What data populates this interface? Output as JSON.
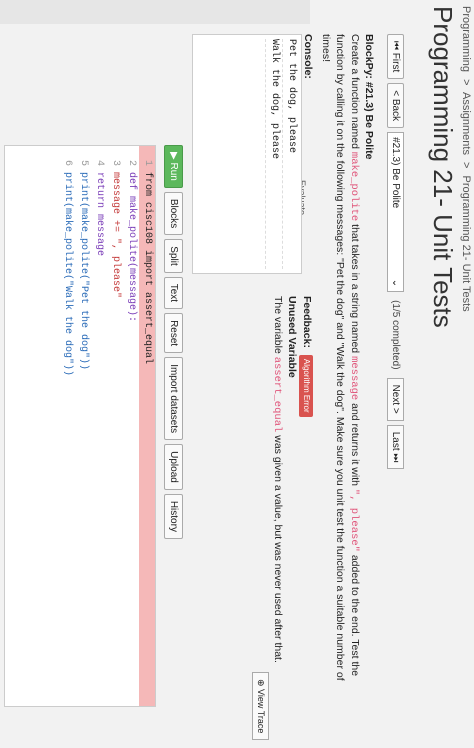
{
  "breadcrumb": [
    "Programming",
    ">",
    "Assignments",
    ">",
    "Programming 21- Unit Tests"
  ],
  "title": "Programming 21- Unit Tests",
  "nav": {
    "first": "⏮ First",
    "back": "< Back",
    "select": "#21.3) Be Polite",
    "progress": "(1/5 completed)",
    "next": "Next >",
    "last": "Last ⏭"
  },
  "problem": {
    "header": "BlockPy: #21.3) Be Polite",
    "part1": "Create a function named",
    "fn_name": "make_polite",
    "part2": "that takes in a string named",
    "param": "message",
    "part3": "and returns it with",
    "suffix": "\", please\"",
    "part4": "added to the end. Test the function by calling it on the following messages: \"Pet the dog\" and \"Walk the dog\". Make sure you unit test the function a suitable number of times!"
  },
  "console": {
    "label": "Console:",
    "lines": [
      "Pet the dog, please",
      "Walk the dog, please"
    ]
  },
  "feedback": {
    "label": "Feedback:",
    "badge": "Algorithm Error",
    "heading": "Unused Variable",
    "text_pre": "The variable",
    "var": "assert_equal",
    "text_post": "was given a value, but was never used after that.",
    "view_trace": "⊕ View Trace"
  },
  "evaluate": "Evaluate",
  "toolbar": {
    "run": "▶ Run",
    "blocks": "Blocks",
    "split": "Split",
    "text": "Text",
    "reset": "Reset",
    "import": "Import datasets",
    "upload": "Upload",
    "history": "History"
  },
  "code": [
    {
      "n": "1",
      "t": "from cisc108 import assert_equal"
    },
    {
      "n": "2",
      "t": "def make_polite(message):"
    },
    {
      "n": "3",
      "t": "    message += \", please\""
    },
    {
      "n": "4",
      "t": "    return message"
    },
    {
      "n": "5",
      "t": "print(make_polite(\"Pet the dog\"))"
    },
    {
      "n": "6",
      "t": "print(make_polite(\"Walk the dog\"))"
    }
  ]
}
